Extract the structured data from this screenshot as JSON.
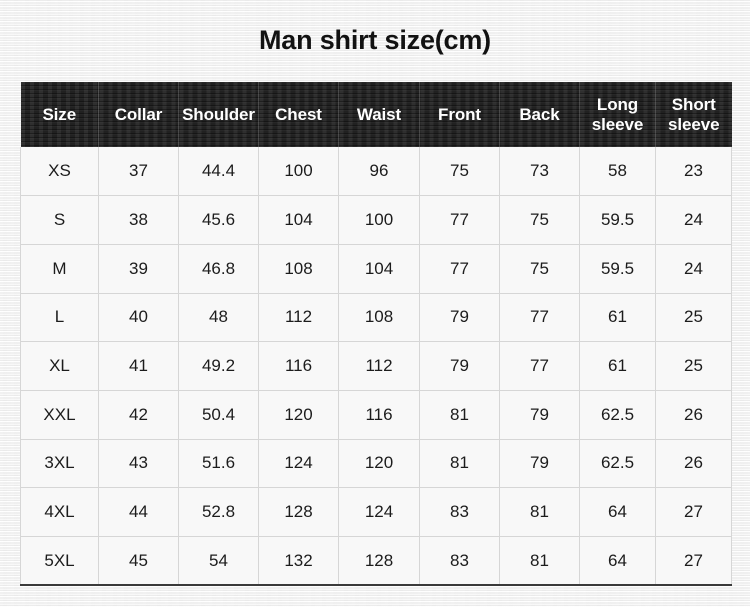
{
  "title": "Man shirt size(cm)",
  "colors": {
    "header_background": "#232323",
    "header_text": "#ffffff",
    "cell_background": "#f8f8f8",
    "cell_text": "#1c1c1c",
    "grid_line": "#d6d6d6",
    "page_background": "#f4f4f4"
  },
  "table": {
    "columns": [
      {
        "label": "Size"
      },
      {
        "label": "Collar"
      },
      {
        "label": "Shoulder"
      },
      {
        "label": "Chest"
      },
      {
        "label": "Waist"
      },
      {
        "label": "Front"
      },
      {
        "label": "Back"
      },
      {
        "label": "Long sleeve"
      },
      {
        "label": "Short sleeve"
      }
    ],
    "rows": [
      {
        "cells": [
          "XS",
          "37",
          "44.4",
          "100",
          "96",
          "75",
          "73",
          "58",
          "23"
        ]
      },
      {
        "cells": [
          "S",
          "38",
          "45.6",
          "104",
          "100",
          "77",
          "75",
          "59.5",
          "24"
        ]
      },
      {
        "cells": [
          "M",
          "39",
          "46.8",
          "108",
          "104",
          "77",
          "75",
          "59.5",
          "24"
        ]
      },
      {
        "cells": [
          "L",
          "40",
          "48",
          "112",
          "108",
          "79",
          "77",
          "61",
          "25"
        ]
      },
      {
        "cells": [
          "XL",
          "41",
          "49.2",
          "116",
          "112",
          "79",
          "77",
          "61",
          "25"
        ]
      },
      {
        "cells": [
          "XXL",
          "42",
          "50.4",
          "120",
          "116",
          "81",
          "79",
          "62.5",
          "26"
        ]
      },
      {
        "cells": [
          "3XL",
          "43",
          "51.6",
          "124",
          "120",
          "81",
          "79",
          "62.5",
          "26"
        ]
      },
      {
        "cells": [
          "4XL",
          "44",
          "52.8",
          "128",
          "124",
          "83",
          "81",
          "64",
          "27"
        ]
      },
      {
        "cells": [
          "5XL",
          "45",
          "54",
          "132",
          "128",
          "83",
          "81",
          "64",
          "27"
        ]
      }
    ]
  },
  "chart_data": {
    "type": "table",
    "title": "Man shirt size(cm)",
    "unit": "cm",
    "columns": [
      "Size",
      "Collar",
      "Shoulder",
      "Chest",
      "Waist",
      "Front",
      "Back",
      "Long sleeve",
      "Short sleeve"
    ],
    "rows": [
      [
        "XS",
        37,
        44.4,
        100,
        96,
        75,
        73,
        58,
        23
      ],
      [
        "S",
        38,
        45.6,
        104,
        100,
        77,
        75,
        59.5,
        24
      ],
      [
        "M",
        39,
        46.8,
        108,
        104,
        77,
        75,
        59.5,
        24
      ],
      [
        "L",
        40,
        48,
        112,
        108,
        79,
        77,
        61,
        25
      ],
      [
        "XL",
        41,
        49.2,
        116,
        112,
        79,
        77,
        61,
        25
      ],
      [
        "XXL",
        42,
        50.4,
        120,
        116,
        81,
        79,
        62.5,
        26
      ],
      [
        "3XL",
        43,
        51.6,
        124,
        120,
        81,
        79,
        62.5,
        26
      ],
      [
        "4XL",
        44,
        52.8,
        128,
        124,
        83,
        81,
        64,
        27
      ],
      [
        "5XL",
        45,
        54,
        132,
        128,
        83,
        81,
        64,
        27
      ]
    ]
  }
}
